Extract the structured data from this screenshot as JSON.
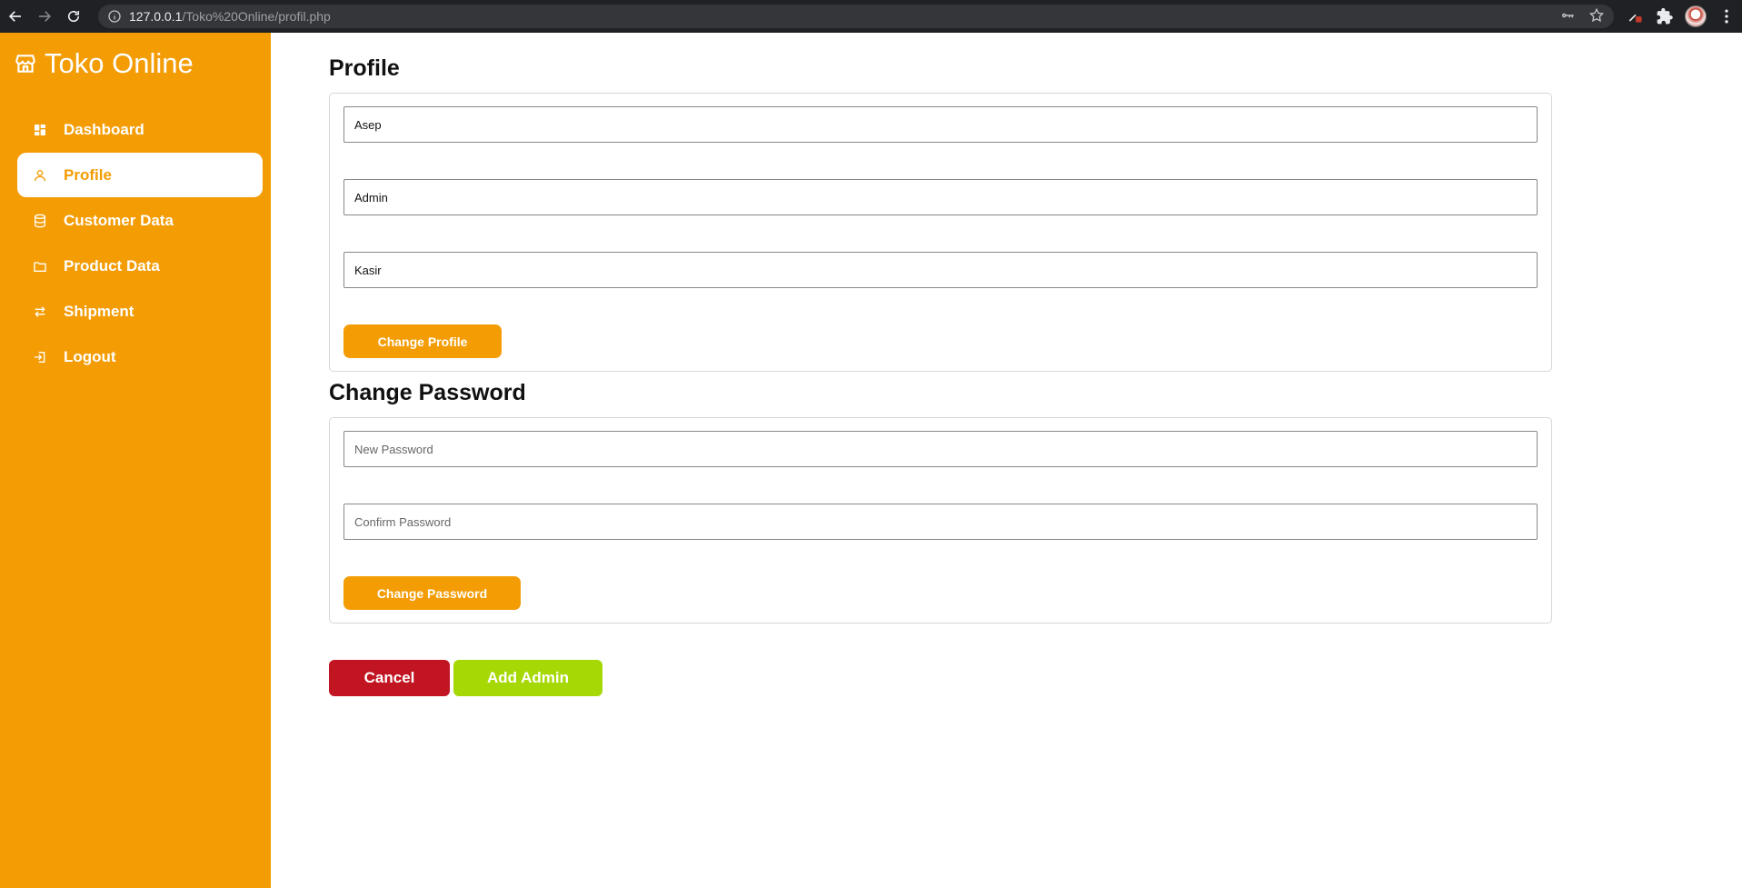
{
  "browser": {
    "url_host": "127.0.0.1",
    "url_path": "/Toko%20Online/profil.php"
  },
  "sidebar": {
    "brand": "Toko Online",
    "items": [
      {
        "label": "Dashboard",
        "icon": "dashboard-icon",
        "active": false
      },
      {
        "label": "Profile",
        "icon": "user-icon",
        "active": true
      },
      {
        "label": "Customer Data",
        "icon": "database-icon",
        "active": false
      },
      {
        "label": "Product Data",
        "icon": "folder-icon",
        "active": false
      },
      {
        "label": "Shipment",
        "icon": "transfer-icon",
        "active": false
      },
      {
        "label": "Logout",
        "icon": "logout-icon",
        "active": false
      }
    ]
  },
  "profile": {
    "title": "Profile",
    "name_value": "Asep",
    "role_value": "Admin",
    "position_value": "Kasir",
    "submit_label": "Change Profile"
  },
  "password": {
    "title": "Change Password",
    "new_placeholder": "New Password",
    "confirm_placeholder": "Confirm Password",
    "submit_label": "Change Password"
  },
  "actions": {
    "cancel_label": "Cancel",
    "add_admin_label": "Add Admin"
  },
  "colors": {
    "brand": "#f39c04",
    "cancel": "#c21522",
    "add_admin": "#a6d805"
  }
}
